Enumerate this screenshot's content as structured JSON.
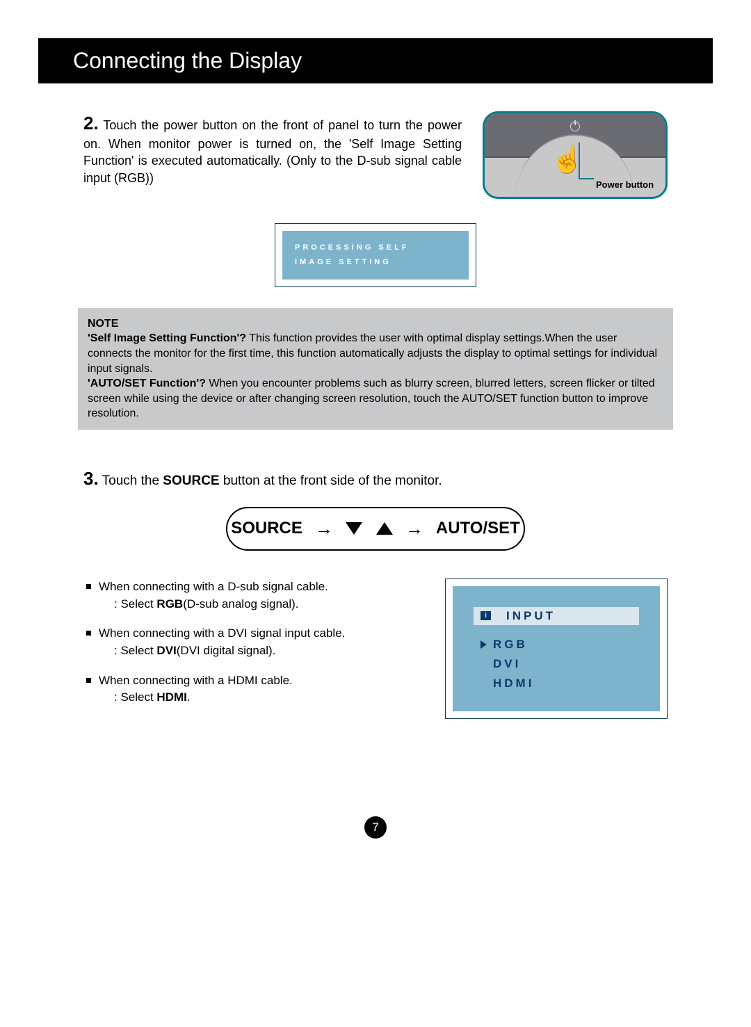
{
  "header": "Connecting the Display",
  "step2": {
    "num": "2.",
    "text": "Touch the power button on the front of panel to turn the power on. When monitor power is turned on, the 'Self Image Setting Function' is executed automatically. (Only to the D-sub signal cable input (RGB))",
    "power_label": "Power button"
  },
  "osd": {
    "line1": "PROCESSING SELF",
    "line2": "IMAGE SETTING"
  },
  "note": {
    "title": "NOTE",
    "q1_label": "'Self Image Setting Function'?",
    "q1_text": " This function provides the user with optimal display settings.When the user connects the monitor for the first time, this function automatically adjusts the display to optimal settings for individual input signals.",
    "q2_label": "'AUTO/SET Function'?",
    "q2_text": " When you encounter problems such as blurry screen, blurred letters, screen flicker or tilted screen while using the device or after changing screen resolution, touch the AUTO/SET function button to improve resolution."
  },
  "step3": {
    "num": "3.",
    "text_before": " Touch the ",
    "bold": "SOURCE",
    "text_after": " button at the front side of the monitor."
  },
  "pill": {
    "source": "SOURCE",
    "autoset": "AUTO/SET"
  },
  "list": {
    "i1_a": "When connecting with a D-sub signal cable.",
    "i1_b_pre": ": Select ",
    "i1_b_bold": "RGB",
    "i1_b_post": "(D-sub analog signal).",
    "i2_a": "When connecting with a DVI signal input cable.",
    "i2_b_pre": ": Select ",
    "i2_b_bold": "DVI",
    "i2_b_post": "(DVI digital signal).",
    "i3_a": "When connecting with a HDMI cable.",
    "i3_b_pre": ": Select ",
    "i3_b_bold": "HDMI",
    "i3_b_post": "."
  },
  "input_panel": {
    "title": "INPUT",
    "opt1": "RGB",
    "opt2": "DVI",
    "opt3": "HDMI"
  },
  "page_number": "7"
}
